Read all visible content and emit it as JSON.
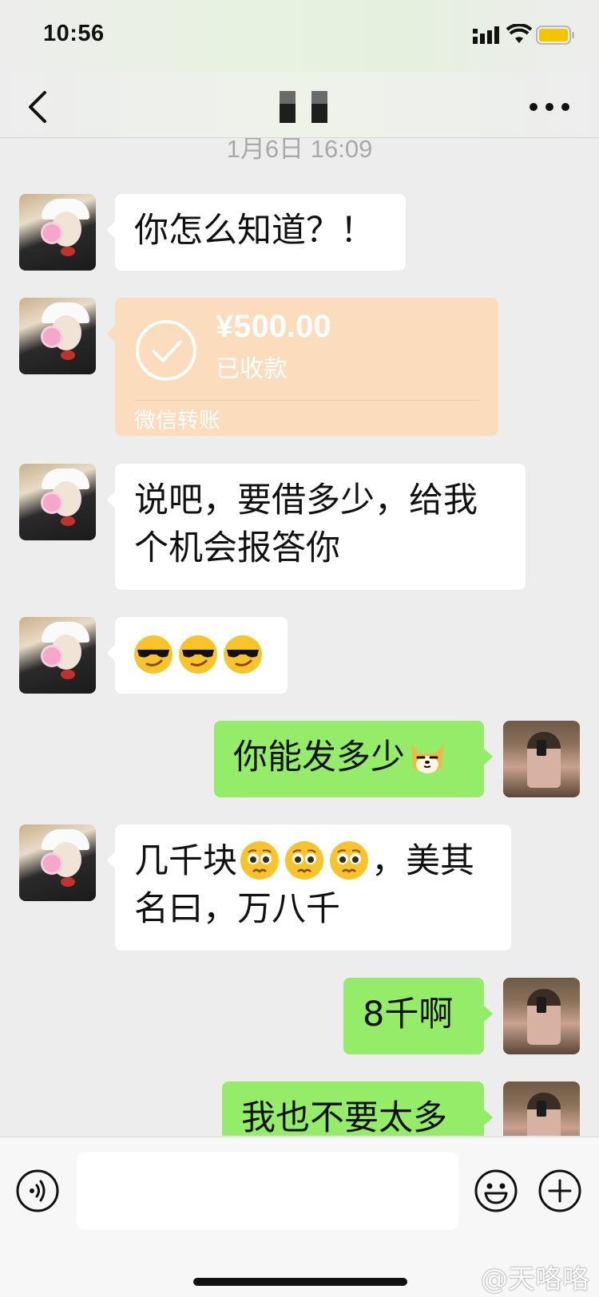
{
  "status_bar": {
    "time": "10:56"
  },
  "header": {
    "title": "▘▘"
  },
  "chat": {
    "timestamp": "1月6日 16:09",
    "messages": [
      {
        "sender": "them",
        "text": "你怎么知道？！"
      },
      {
        "sender": "them",
        "type": "transfer",
        "amount": "¥500.00",
        "status": "已收款",
        "label": "微信转账"
      },
      {
        "sender": "them",
        "text_line1": "说吧，要借多少，给我",
        "text_line2": "个机会报答你"
      },
      {
        "sender": "them",
        "emoji": [
          "sunglasses-smirk-emoji",
          "sunglasses-smirk-emoji",
          "sunglasses-smirk-emoji"
        ]
      },
      {
        "sender": "me",
        "text": "你能发多少",
        "emoji": "shiba-dog-emoji"
      },
      {
        "sender": "them",
        "text_a": "几千块",
        "text_b": "，美其",
        "text_line2": "名曰，万八千",
        "emoji": [
          "pleading-face-emoji",
          "pleading-face-emoji",
          "pleading-face-emoji"
        ]
      },
      {
        "sender": "me",
        "text": "8千啊"
      },
      {
        "sender": "me",
        "text": "我也不要太多"
      }
    ]
  },
  "input_bar": {
    "value": "",
    "placeholder": ""
  },
  "watermark": "@天咯咯",
  "colors": {
    "me_bubble": "#95ec69",
    "them_bubble": "#ffffff",
    "transfer_card": "#fbdcbc",
    "background": "#ededed"
  }
}
